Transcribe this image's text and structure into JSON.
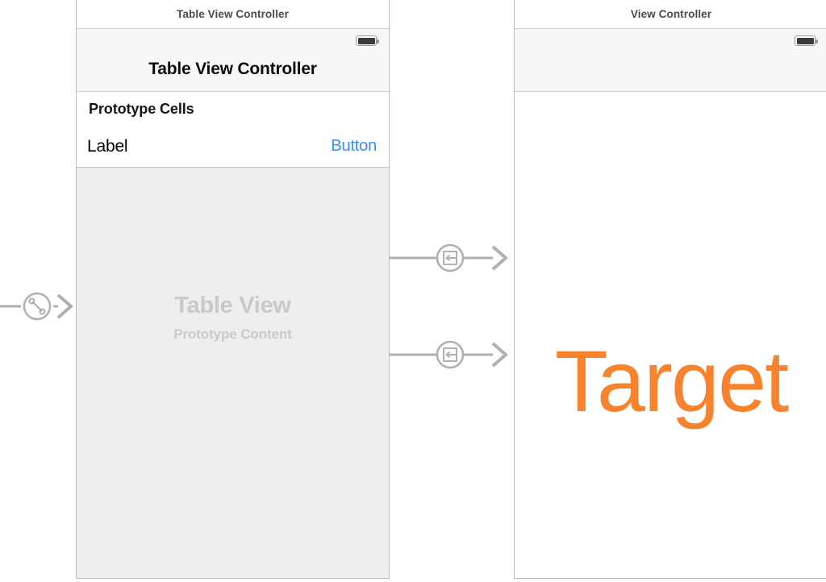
{
  "canvas": {
    "background": "#ffffff",
    "line_color": "#b0b0b0"
  },
  "scenes": [
    {
      "id": "table-view-controller",
      "titlebar": "Table View Controller",
      "nav_title": "Table View Controller",
      "status_bar": {
        "battery_icon": "battery-full-icon"
      },
      "table": {
        "section_header": "Prototype Cells",
        "cells": [
          {
            "label": "Label",
            "accessory_label": "Button",
            "accessory_color": "#3c8df0"
          }
        ],
        "placeholder_title": "Table View",
        "placeholder_subtitle": "Prototype Content",
        "placeholder_color": "#c9c9c9",
        "placeholder_background": "#eeeeee"
      }
    },
    {
      "id": "view-controller",
      "titlebar": "View Controller",
      "nav_title": "",
      "status_bar": {
        "battery_icon": "battery-full-icon"
      },
      "content": {
        "label": "Target",
        "label_color": "#f7832f"
      }
    }
  ],
  "connections": [
    {
      "id": "storyboard-entry-point",
      "icon": "relationship-segue-icon",
      "label": "",
      "target_scene": "table-view-controller"
    },
    {
      "id": "show-segue-1",
      "icon": "show-segue-icon",
      "label": "",
      "source_scene": "table-view-controller",
      "target_scene": "view-controller"
    },
    {
      "id": "show-segue-2",
      "icon": "show-segue-icon",
      "label": "",
      "source_scene": "table-view-controller",
      "target_scene": "view-controller"
    }
  ]
}
